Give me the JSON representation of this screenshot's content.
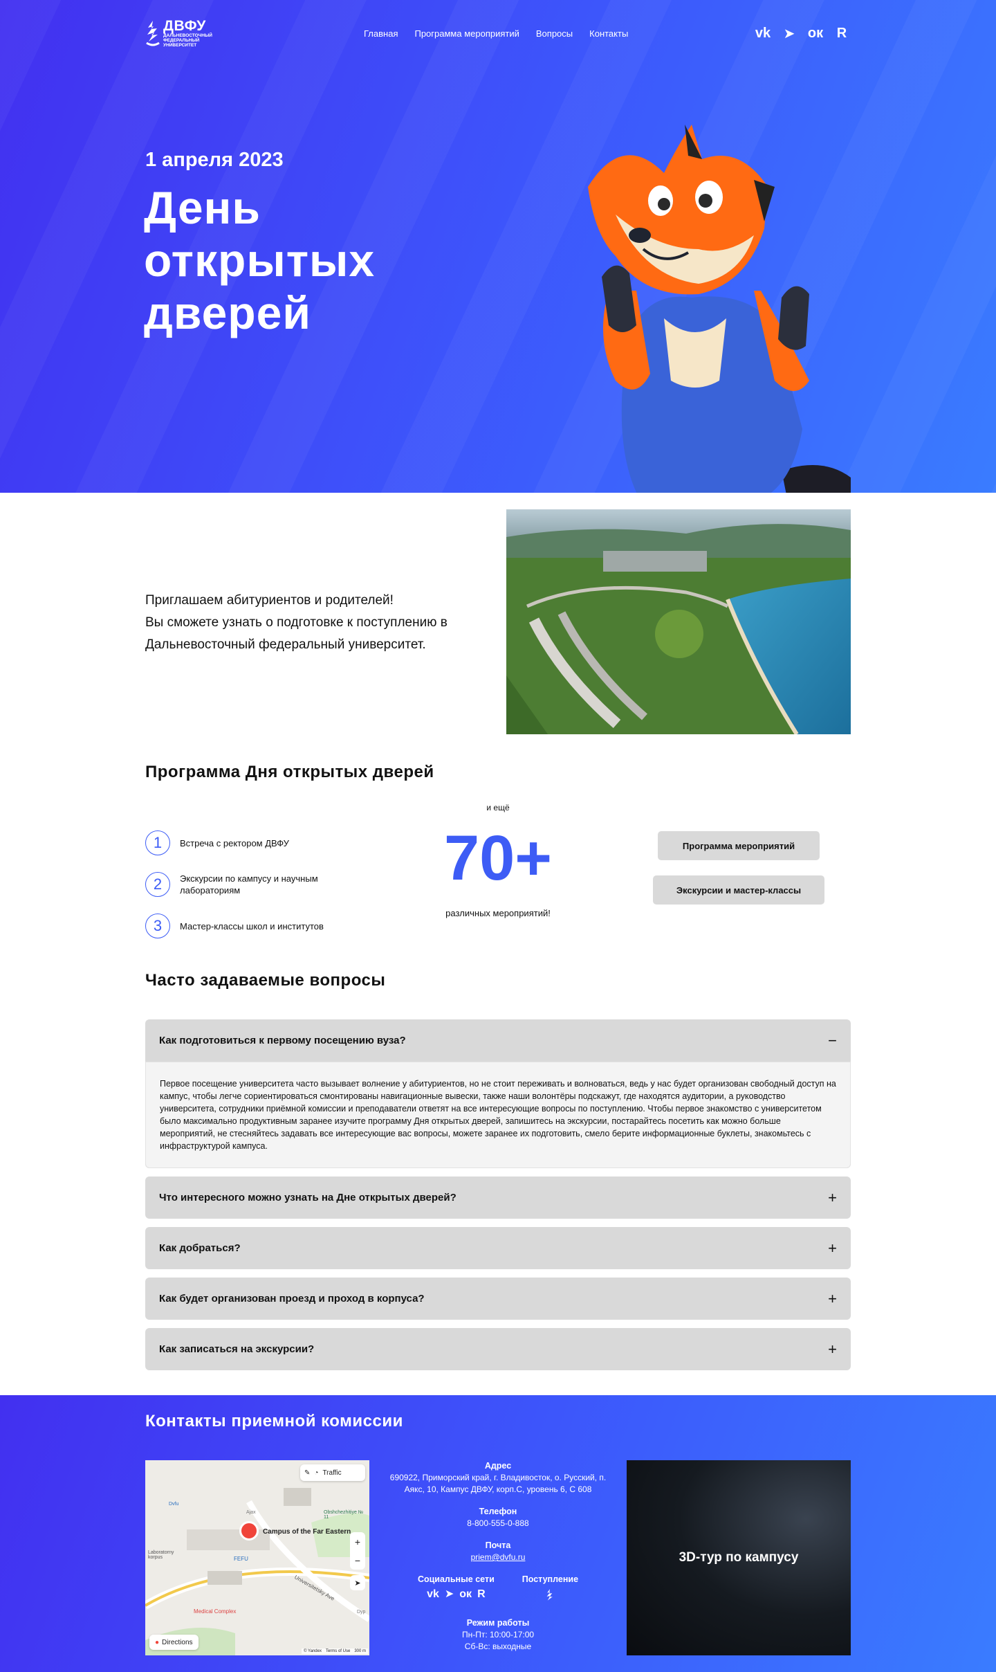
{
  "header": {
    "logo_main": "ДВФУ",
    "logo_sub": [
      "ДАЛЬНЕВОСТОЧНЫЙ",
      "ФЕДЕРАЛЬНЫЙ",
      "УНИВЕРСИТЕТ"
    ],
    "nav": [
      "Главная",
      "Программа мероприятий",
      "Вопросы",
      "Контакты"
    ],
    "social": [
      {
        "icon": "vk-icon",
        "glyph": "vk"
      },
      {
        "icon": "telegram-icon",
        "glyph": "➤"
      },
      {
        "icon": "odnoklassniki-icon",
        "glyph": "ок"
      },
      {
        "icon": "rutube-icon",
        "glyph": "R"
      }
    ]
  },
  "hero": {
    "date": "1 апреля 2023",
    "title_lines": [
      "День",
      "открытых",
      "дверей"
    ]
  },
  "intro": {
    "lines": [
      "Приглашаем абитуриентов и родителей!",
      "Вы сможете узнать о подготовке к поступлению в",
      "Дальневосточный федеральный университет."
    ]
  },
  "program": {
    "title": "Программа Дня открытых дверей",
    "steps": [
      {
        "num": "1",
        "label": "Встреча с ректором ДВФУ"
      },
      {
        "num": "2",
        "label": "Экскурсии по кампусу и научным лабораториям"
      },
      {
        "num": "3",
        "label": "Мастер-классы школ и институтов"
      }
    ],
    "stat_more": "и ещё",
    "stat_num": "70+",
    "stat_sub": "различных мероприятий!",
    "button_program": "Программа мероприятий",
    "button_tours": "Экскурсии и мастер-классы"
  },
  "faq": {
    "title": "Часто задаваемые вопросы",
    "items": [
      {
        "q": "Как подготовиться к первому посещению вуза?",
        "sign": "−",
        "a": "Первое посещение университета часто вызывает волнение у абитуриентов, но не стоит переживать и волноваться, ведь у нас будет организован свободный доступ на кампус, чтобы легче сориентироваться смонтированы навигационные вывески, также наши волонтёры подскажут, где находятся аудитории, а руководство университета, сотрудники приёмной комиссии и преподаватели ответят на все интересующие вопросы по поступлению. Чтобы первое знакомство с университетом было максимально продуктивным заранее изучите программу Дня открытых дверей, запишитесь на экскурсии, постарайтесь посетить как можно больше мероприятий, не стесняйтесь задавать все интересующие вас вопросы, можете заранее их подготовить, смело берите информационные буклеты, знакомьтесь с инфраструктурой кампуса."
      },
      {
        "q": "Что интересного можно узнать на Дне открытых дверей?",
        "sign": "+"
      },
      {
        "q": "Как добраться?",
        "sign": "+"
      },
      {
        "q": "Как будет организован проезд и проход в корпуса?",
        "sign": "+"
      },
      {
        "q": "Как записаться на экскурсии?",
        "sign": "+"
      }
    ]
  },
  "contacts": {
    "title": "Контакты приемной комиссии",
    "address_label": "Адрес",
    "address": "690922, Приморский край, г. Владивосток, о. Русский, п. Аякс, 10, Кампус ДВФУ, корп.С, уровень 6, С 608",
    "phone_label": "Телефон",
    "phone": "8-800-555-0-888",
    "email_label": "Почта",
    "email": "priem@dvfu.ru",
    "social_label": "Социальные сети",
    "admission_label": "Поступление",
    "hours_label": "Режим работы",
    "hours_weekdays": "Пн-Пт: 10:00-17:00",
    "hours_weekend": "Сб-Вс: выходные",
    "tour_label": "3D-тур по кампусу",
    "map": {
      "traffic": "Traffic",
      "place": "Campus of the Far Eastern",
      "directions": "Directions",
      "labels": [
        "Ajax",
        "Obshchezhitiye № 11",
        "Dvfu",
        "Laboratorny korpus",
        "FEFU",
        "Medical Complex",
        "Universitetsky Ave",
        "Dyp"
      ],
      "copyright": "© Yandex",
      "terms": "Terms of Use",
      "scale": "300 m"
    }
  }
}
